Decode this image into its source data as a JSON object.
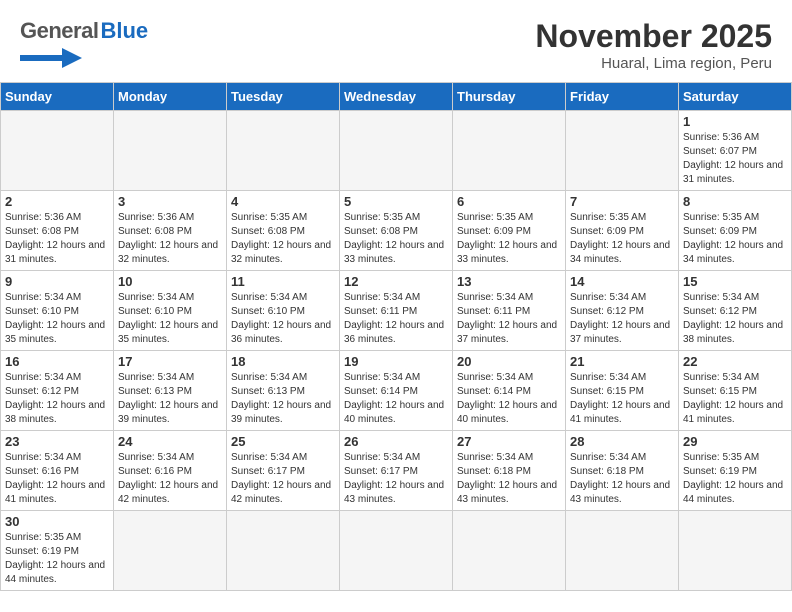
{
  "title": "November 2025",
  "subtitle": "Huaral, Lima region, Peru",
  "logo": {
    "general": "General",
    "blue": "Blue"
  },
  "weekdays": [
    "Sunday",
    "Monday",
    "Tuesday",
    "Wednesday",
    "Thursday",
    "Friday",
    "Saturday"
  ],
  "weeks": [
    [
      {
        "day": "",
        "info": ""
      },
      {
        "day": "",
        "info": ""
      },
      {
        "day": "",
        "info": ""
      },
      {
        "day": "",
        "info": ""
      },
      {
        "day": "",
        "info": ""
      },
      {
        "day": "",
        "info": ""
      },
      {
        "day": "1",
        "info": "Sunrise: 5:36 AM\nSunset: 6:07 PM\nDaylight: 12 hours and 31 minutes."
      }
    ],
    [
      {
        "day": "2",
        "info": "Sunrise: 5:36 AM\nSunset: 6:08 PM\nDaylight: 12 hours and 31 minutes."
      },
      {
        "day": "3",
        "info": "Sunrise: 5:36 AM\nSunset: 6:08 PM\nDaylight: 12 hours and 32 minutes."
      },
      {
        "day": "4",
        "info": "Sunrise: 5:35 AM\nSunset: 6:08 PM\nDaylight: 12 hours and 32 minutes."
      },
      {
        "day": "5",
        "info": "Sunrise: 5:35 AM\nSunset: 6:08 PM\nDaylight: 12 hours and 33 minutes."
      },
      {
        "day": "6",
        "info": "Sunrise: 5:35 AM\nSunset: 6:09 PM\nDaylight: 12 hours and 33 minutes."
      },
      {
        "day": "7",
        "info": "Sunrise: 5:35 AM\nSunset: 6:09 PM\nDaylight: 12 hours and 34 minutes."
      },
      {
        "day": "8",
        "info": "Sunrise: 5:35 AM\nSunset: 6:09 PM\nDaylight: 12 hours and 34 minutes."
      }
    ],
    [
      {
        "day": "9",
        "info": "Sunrise: 5:34 AM\nSunset: 6:10 PM\nDaylight: 12 hours and 35 minutes."
      },
      {
        "day": "10",
        "info": "Sunrise: 5:34 AM\nSunset: 6:10 PM\nDaylight: 12 hours and 35 minutes."
      },
      {
        "day": "11",
        "info": "Sunrise: 5:34 AM\nSunset: 6:10 PM\nDaylight: 12 hours and 36 minutes."
      },
      {
        "day": "12",
        "info": "Sunrise: 5:34 AM\nSunset: 6:11 PM\nDaylight: 12 hours and 36 minutes."
      },
      {
        "day": "13",
        "info": "Sunrise: 5:34 AM\nSunset: 6:11 PM\nDaylight: 12 hours and 37 minutes."
      },
      {
        "day": "14",
        "info": "Sunrise: 5:34 AM\nSunset: 6:12 PM\nDaylight: 12 hours and 37 minutes."
      },
      {
        "day": "15",
        "info": "Sunrise: 5:34 AM\nSunset: 6:12 PM\nDaylight: 12 hours and 38 minutes."
      }
    ],
    [
      {
        "day": "16",
        "info": "Sunrise: 5:34 AM\nSunset: 6:12 PM\nDaylight: 12 hours and 38 minutes."
      },
      {
        "day": "17",
        "info": "Sunrise: 5:34 AM\nSunset: 6:13 PM\nDaylight: 12 hours and 39 minutes."
      },
      {
        "day": "18",
        "info": "Sunrise: 5:34 AM\nSunset: 6:13 PM\nDaylight: 12 hours and 39 minutes."
      },
      {
        "day": "19",
        "info": "Sunrise: 5:34 AM\nSunset: 6:14 PM\nDaylight: 12 hours and 40 minutes."
      },
      {
        "day": "20",
        "info": "Sunrise: 5:34 AM\nSunset: 6:14 PM\nDaylight: 12 hours and 40 minutes."
      },
      {
        "day": "21",
        "info": "Sunrise: 5:34 AM\nSunset: 6:15 PM\nDaylight: 12 hours and 41 minutes."
      },
      {
        "day": "22",
        "info": "Sunrise: 5:34 AM\nSunset: 6:15 PM\nDaylight: 12 hours and 41 minutes."
      }
    ],
    [
      {
        "day": "23",
        "info": "Sunrise: 5:34 AM\nSunset: 6:16 PM\nDaylight: 12 hours and 41 minutes."
      },
      {
        "day": "24",
        "info": "Sunrise: 5:34 AM\nSunset: 6:16 PM\nDaylight: 12 hours and 42 minutes."
      },
      {
        "day": "25",
        "info": "Sunrise: 5:34 AM\nSunset: 6:17 PM\nDaylight: 12 hours and 42 minutes."
      },
      {
        "day": "26",
        "info": "Sunrise: 5:34 AM\nSunset: 6:17 PM\nDaylight: 12 hours and 43 minutes."
      },
      {
        "day": "27",
        "info": "Sunrise: 5:34 AM\nSunset: 6:18 PM\nDaylight: 12 hours and 43 minutes."
      },
      {
        "day": "28",
        "info": "Sunrise: 5:34 AM\nSunset: 6:18 PM\nDaylight: 12 hours and 43 minutes."
      },
      {
        "day": "29",
        "info": "Sunrise: 5:35 AM\nSunset: 6:19 PM\nDaylight: 12 hours and 44 minutes."
      }
    ],
    [
      {
        "day": "30",
        "info": "Sunrise: 5:35 AM\nSunset: 6:19 PM\nDaylight: 12 hours and 44 minutes."
      },
      {
        "day": "",
        "info": ""
      },
      {
        "day": "",
        "info": ""
      },
      {
        "day": "",
        "info": ""
      },
      {
        "day": "",
        "info": ""
      },
      {
        "day": "",
        "info": ""
      },
      {
        "day": "",
        "info": ""
      }
    ]
  ]
}
